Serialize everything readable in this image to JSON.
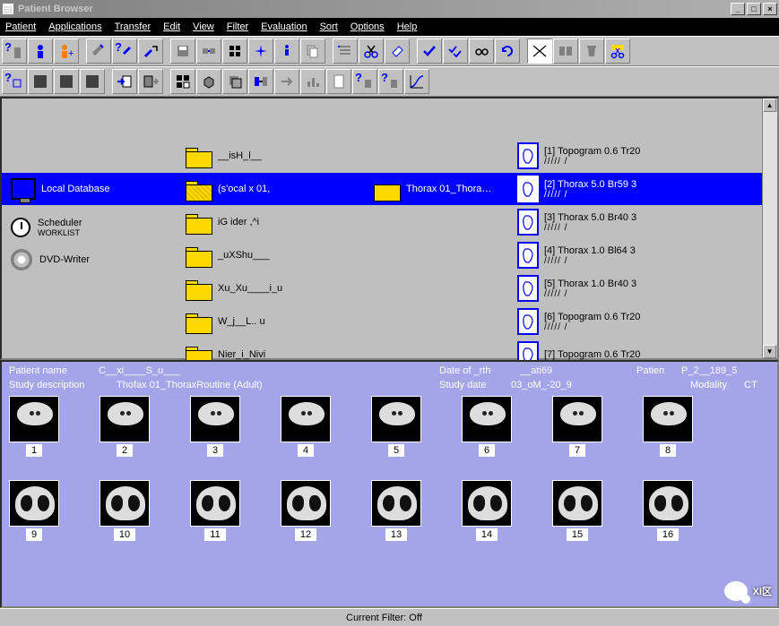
{
  "window": {
    "title": "Patient Browser"
  },
  "menu": [
    "Patient",
    "Applications",
    "Transfer",
    "Edit",
    "View",
    "Filter",
    "Evaluation",
    "Sort",
    "Options",
    "Help"
  ],
  "left_pane": {
    "local_db": "Local Database",
    "scheduler": "Scheduler",
    "scheduler_sub": "WORKLIST",
    "dvd": "DVD-Writer"
  },
  "selected_study": "Thorax 01_Thora…",
  "folders_text": [
    "__isH_l__",
    "(s'ocal x 01,",
    "iG   ider ,^i",
    "_uXShu___",
    "Xu_Xu____i_u",
    "W_j__L.. u",
    "Nier_i_Nivi"
  ],
  "series": [
    {
      "label": "[1] Topogram 0.6 Tr20",
      "sub": "///// /"
    },
    {
      "label": "[2] Thorax 5.0 Br59 3",
      "sub": "///// /"
    },
    {
      "label": "[3] Thorax 5.0 Br40 3",
      "sub": "///// /"
    },
    {
      "label": "[4] Thorax 1.0 Bl64 3",
      "sub": "///// /"
    },
    {
      "label": "[5] Thorax 1.0 Br40 3",
      "sub": "///// /"
    },
    {
      "label": "[6] Topogram 0.6 Tr20",
      "sub": "///// /"
    },
    {
      "label": "[7] Topogram 0.6 Tr20",
      "sub": ""
    }
  ],
  "preview": {
    "patient_name_label": "Patient name",
    "patient_name_value": "C__xi____S_u___",
    "dob_label": "Date of _rth",
    "dob_value": "__ati69",
    "patient_id_label": "Patien",
    "patient_id_value": "P_2__189_5",
    "study_desc_label": "Study description",
    "study_desc_value": "Thofax 01_ThoraxRoutine (Adult)",
    "study_date_label": "Study date",
    "study_date_value": "03_oM_-20_9",
    "modality_label": "Modality",
    "modality_value": "CT",
    "thumbs": [
      "1",
      "2",
      "3",
      "4",
      "5",
      "6",
      "7",
      "8",
      "9",
      "10",
      "11",
      "12",
      "13",
      "14",
      "15",
      "16"
    ]
  },
  "status": {
    "filter": "Current Filter: Off"
  },
  "watermark": "XI区"
}
